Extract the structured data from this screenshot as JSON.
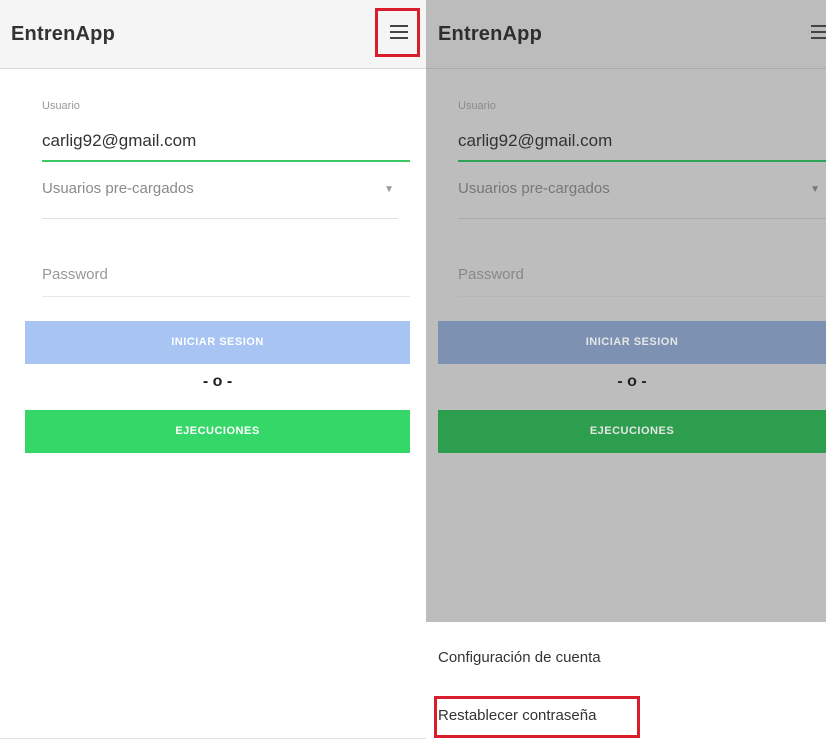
{
  "left": {
    "app_title": "EntrenApp",
    "menu_icon": "hamburger-menu-icon",
    "usuario_label": "Usuario",
    "usuario_value": "carlig92@gmail.com",
    "preloaded_select": "Usuarios pre-cargados",
    "password_placeholder": "Password",
    "login_button": "INICIAR SESION",
    "separator": "- o -",
    "executions_button": "EJECUCIONES"
  },
  "right": {
    "app_title": "EntrenApp",
    "menu_icon": "hamburger-menu-icon",
    "usuario_label": "Usuario",
    "usuario_value": "carlig92@gmail.com",
    "preloaded_select": "Usuarios pre-cargados",
    "password_placeholder": "Password",
    "login_button": "INICIAR SESION",
    "separator": "- o -",
    "executions_button": "EJECUCIONES",
    "drawer": {
      "items": [
        {
          "label": "Configuración de cuenta"
        },
        {
          "label": "Restablecer contraseña"
        }
      ]
    }
  },
  "colors": {
    "accent_green": "#35d768",
    "login_blue": "#a7c4f2",
    "highlight_red": "#d81e2a",
    "overlay_gray": "#bdbdbd"
  }
}
